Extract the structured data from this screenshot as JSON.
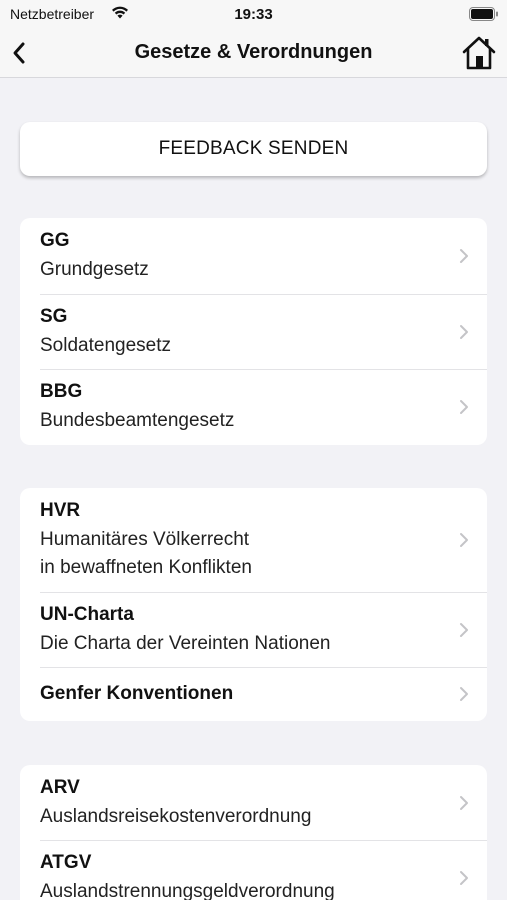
{
  "statusbar": {
    "carrier": "Netzbetreiber",
    "time": "19:33",
    "wifi_icon": "wifi-icon",
    "battery_icon": "battery-icon"
  },
  "navbar": {
    "title": "Gesetze & Verordnungen",
    "back_icon": "chevron-left-icon",
    "home_icon": "home-icon"
  },
  "feedback": {
    "label": "FEEDBACK SENDEN"
  },
  "groups": [
    {
      "items": [
        {
          "title": "GG",
          "subtitle": "Grundgesetz"
        },
        {
          "title": "SG",
          "subtitle": "Soldatengesetz"
        },
        {
          "title": "BBG",
          "subtitle": "Bundesbeamtengesetz"
        }
      ]
    },
    {
      "items": [
        {
          "title": "HVR",
          "subtitle": "Humanitäres Völkerrecht\nin bewaffneten Konflikten"
        },
        {
          "title": "UN-Charta",
          "subtitle": "Die Charta der Vereinten Nationen"
        },
        {
          "title": "Genfer Konventionen"
        }
      ]
    },
    {
      "items": [
        {
          "title": "ARV",
          "subtitle": "Auslandsreisekostenverordnung"
        },
        {
          "title": "ATGV",
          "subtitle": "Auslandstrennungsgeldverordnung"
        }
      ]
    }
  ],
  "colors": {
    "background": "#f2f2f6",
    "card": "#ffffff",
    "chevron": "#c4c4c7",
    "text": "#111111"
  }
}
